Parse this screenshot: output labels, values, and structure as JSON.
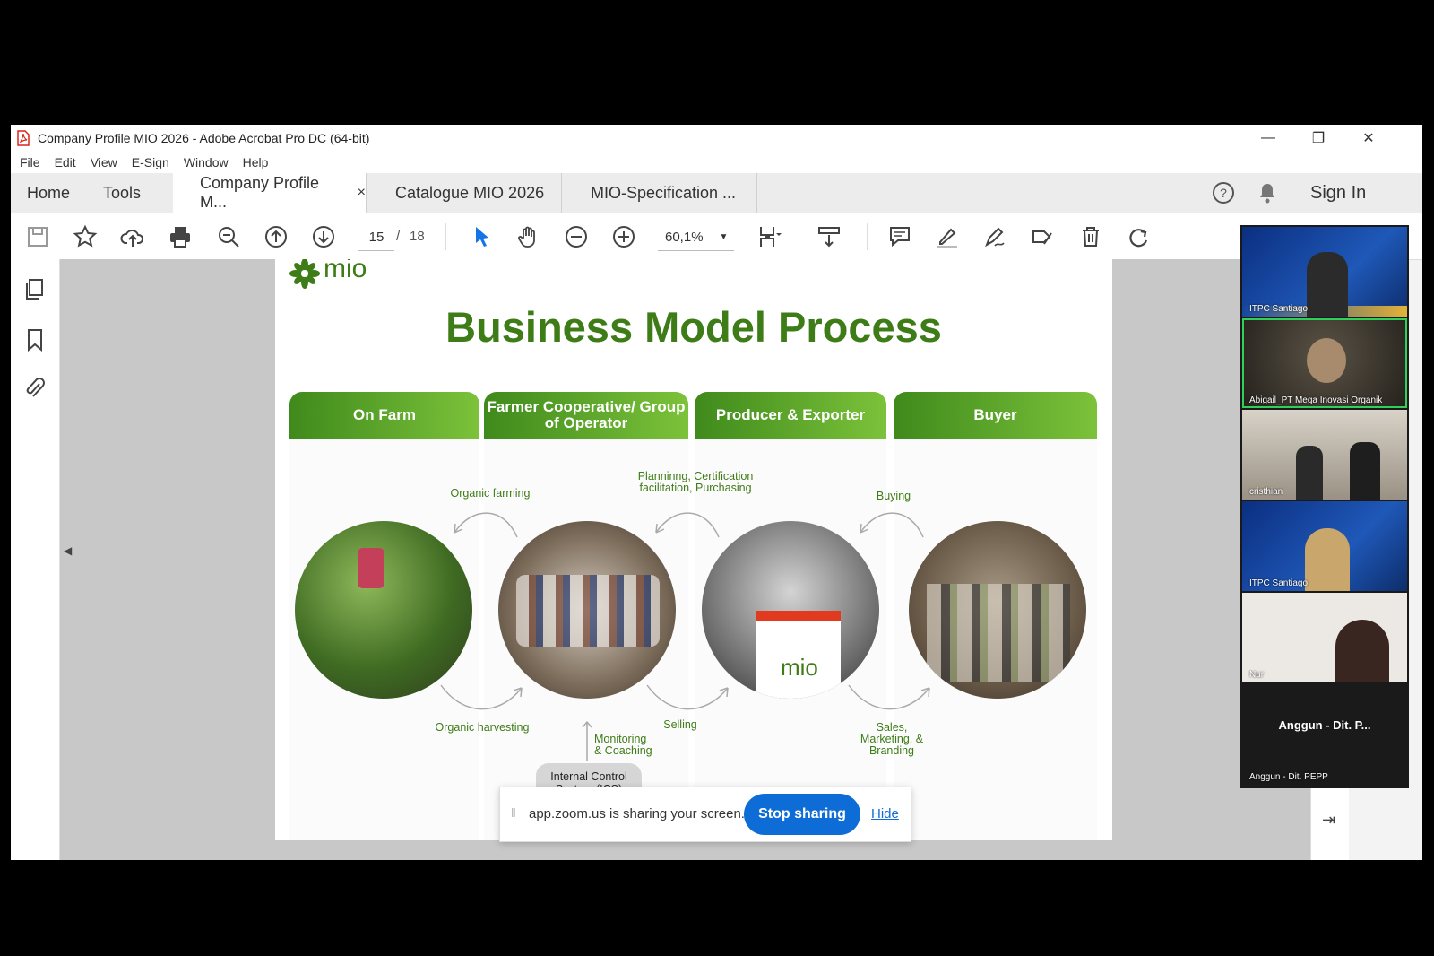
{
  "window": {
    "title": "Company Profile MIO 2026 - Adobe Acrobat Pro DC (64-bit)",
    "controls": {
      "minimize": "—",
      "restore": "❐",
      "close": "✕"
    }
  },
  "menu": [
    "File",
    "Edit",
    "View",
    "E-Sign",
    "Window",
    "Help"
  ],
  "tabs": {
    "home": "Home",
    "tools": "Tools",
    "docs": [
      {
        "label": "Company Profile M...",
        "close": "×"
      },
      {
        "label": "Catalogue MIO 2026"
      },
      {
        "label": "MIO-Specification ..."
      }
    ],
    "sign_in": "Sign In"
  },
  "toolbar": {
    "page_current": "15",
    "page_sep": "/",
    "page_total": "18",
    "zoom": "60,1%"
  },
  "slide": {
    "logo": "mio",
    "title": "Business Model Process",
    "phases": [
      "On Farm",
      "Farmer Cooperative/ Group of Operator",
      "Producer & Exporter",
      "Buyer"
    ],
    "labels": {
      "organic_farming": "Organic farming",
      "planning": "Planninng, Certification facilitation, Purchasing",
      "buying": "Buying",
      "organic_harvesting": "Organic harvesting",
      "monitoring": "Monitoring & Coaching",
      "selling": "Selling",
      "sales": "Sales, Marketing, & Branding",
      "ics": "Internal Control System (ICS)",
      "booth_logo": "mio"
    }
  },
  "share_bar": {
    "message": "app.zoom.us is sharing your screen.",
    "stop": "Stop sharing",
    "hide": "Hide"
  },
  "zoom_participants": [
    {
      "name": "ITPC Santiago"
    },
    {
      "name": "Abigail_PT Mega Inovasi Organik"
    },
    {
      "name": "cristhian"
    },
    {
      "name": "ITPC Santiago"
    },
    {
      "name": "Nur"
    },
    {
      "name": "Anggun - Dit. PEPP",
      "display": "Anggun - Dit. P..."
    }
  ],
  "colors": {
    "brand_green": "#3e7c17",
    "accent_blue": "#0e6cd6"
  }
}
